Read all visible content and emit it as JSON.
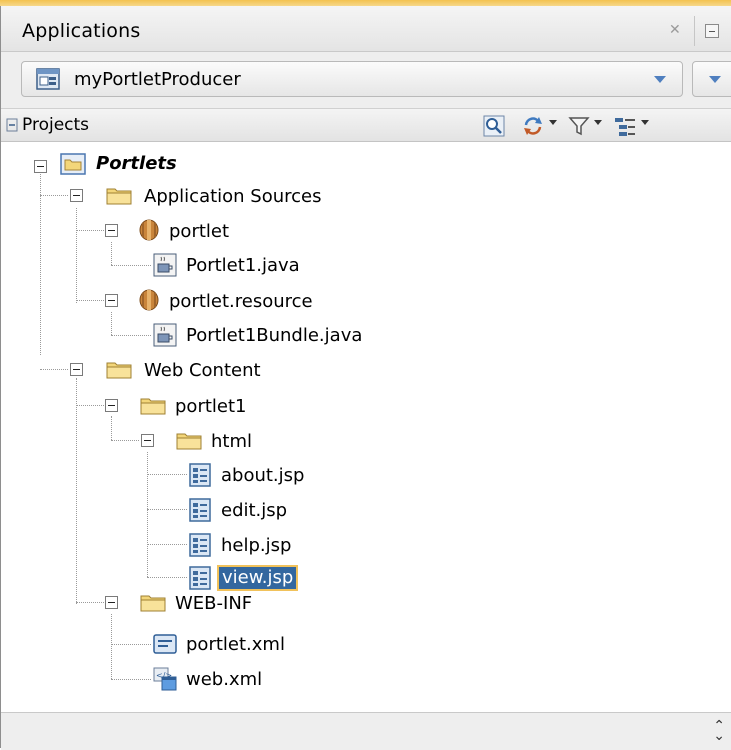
{
  "window": {
    "title": "Applications"
  },
  "application_selector": {
    "value": "myPortletProducer"
  },
  "projects_bar": {
    "title": "Projects",
    "toolbar_icons": [
      "find-icon",
      "sync-icon",
      "filter-icon",
      "view-options-icon"
    ]
  },
  "tree": {
    "root": "Portlets",
    "application_sources": "Application Sources",
    "pkg_portlet": "portlet",
    "file_portlet1": "Portlet1.java",
    "pkg_portlet_resource": "portlet.resource",
    "file_bundle": "Portlet1Bundle.java",
    "web_content": "Web Content",
    "folder_portlet1": "portlet1",
    "folder_html": "html",
    "file_about": "about.jsp",
    "file_edit": "edit.jsp",
    "file_help": "help.jsp",
    "file_view": "view.jsp",
    "folder_webinf": "WEB-INF",
    "file_portlet_xml": "portlet.xml",
    "file_web_xml": "web.xml",
    "selected": "view.jsp"
  },
  "colors": {
    "accent_top": "#f3c24f",
    "selection_bg": "#33679f",
    "selection_outline": "#f1c25b",
    "dropdown_arrow": "#4f7fbf"
  }
}
